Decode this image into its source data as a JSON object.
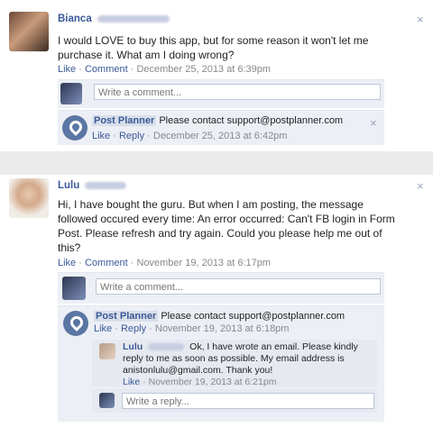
{
  "posts": [
    {
      "author_first": "Bianca",
      "comment": "I would LOVE to buy this app, but for some reason it won't let me purchase it. What am I doing wrong?",
      "like": "Like",
      "comment_link": "Comment",
      "date": "December 25, 2013 at 6:39pm",
      "write_placeholder": "Write a comment...",
      "reply": {
        "author": "Post Planner",
        "text": "Please contact support@postplanner.com",
        "like": "Like",
        "reply_link": "Reply",
        "date": "December 25, 2013 at 6:42pm"
      }
    },
    {
      "author_first": "Lulu",
      "comment": "Hi, I have bought the guru. But when I am posting, the message followed occured every time: An error occurred: Can't FB login in Form Post. Please refresh and try again. Could you please help me out of this?",
      "like": "Like",
      "comment_link": "Comment",
      "date": "November 19, 2013 at 6:17pm",
      "write_placeholder": "Write a comment...",
      "reply": {
        "author": "Post Planner",
        "text": "Please contact support@postplanner.com",
        "like": "Like",
        "reply_link": "Reply",
        "date": "November 19, 2013 at 6:18pm"
      },
      "subreply": {
        "author": "Lulu",
        "text": "Ok, I have wrote an email. Please kindly reply to me as soon as possible. My email address is anistonlulu@gmail.com. Thank you!",
        "like": "Like",
        "date": "November 19, 2013 at 6:21pm"
      },
      "write_reply_placeholder": "Write a reply..."
    }
  ],
  "close_glyph": "×",
  "separator": " · "
}
